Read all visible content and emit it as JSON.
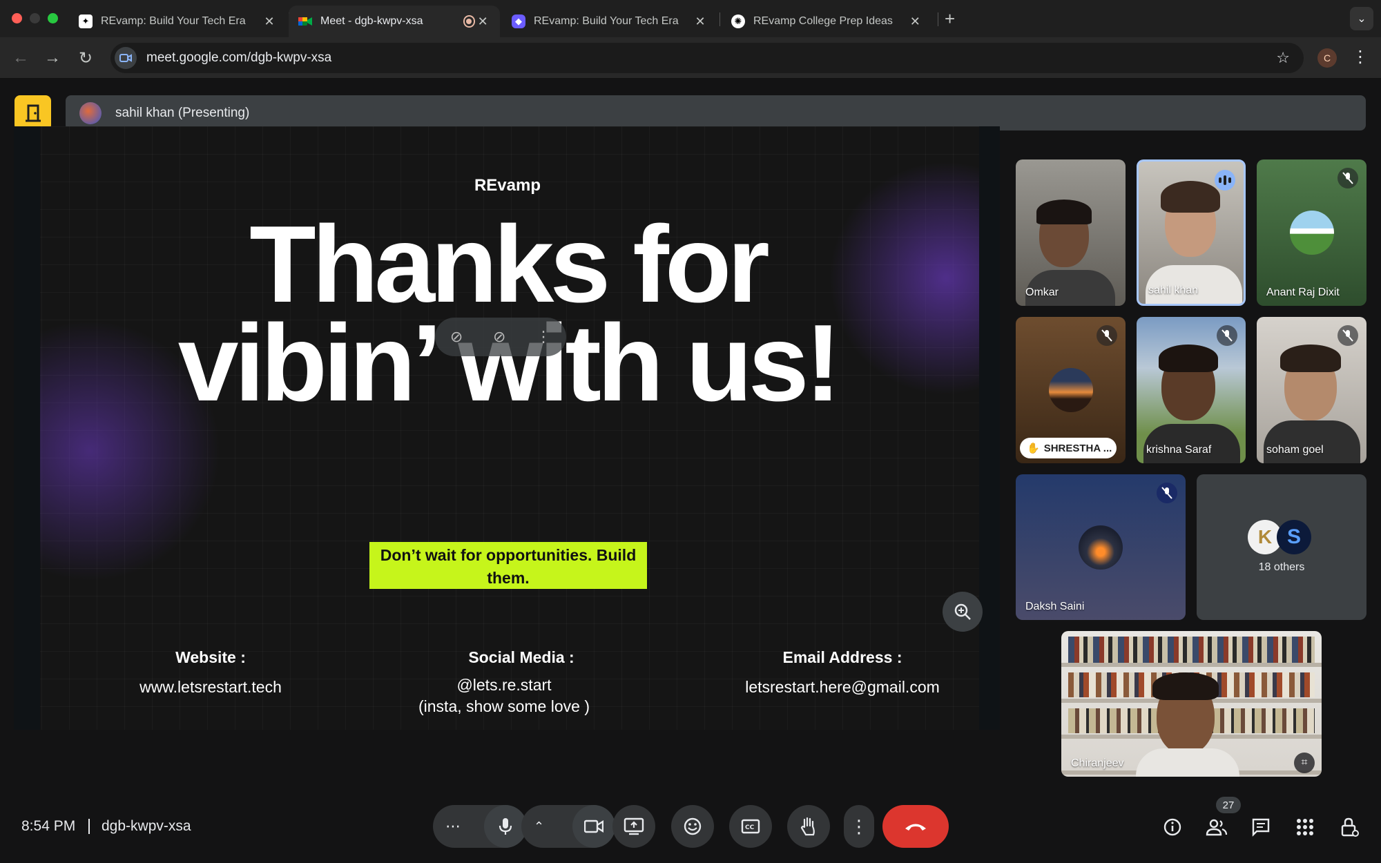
{
  "browser": {
    "tabs": [
      {
        "title": "REvamp: Build Your Tech Era"
      },
      {
        "title": "Meet - dgb-kwpv-xsa"
      },
      {
        "title": "REvamp: Build Your Tech Era"
      },
      {
        "title": "REvamp College Prep Ideas"
      }
    ],
    "url": "meet.google.com/dgb-kwpv-xsa",
    "profile_initial": "C"
  },
  "meet": {
    "presenter_label": "sahil khan (Presenting)",
    "slide": {
      "brand": "REvamp",
      "headline_line1": "Thanks for",
      "headline_line2": "vibin’ with us!",
      "cta": "Don’t wait for opportunities. Build them.",
      "website_label": "Website :",
      "website_value": "www.letsrestart.tech",
      "social_label": "Social Media :",
      "social_value_1": "@lets.re.start",
      "social_value_2": "(insta, show some love )",
      "email_label": "Email Address :",
      "email_value": "letsrestart.here@gmail.com"
    },
    "participants": [
      {
        "name": "Omkar"
      },
      {
        "name": "sahil khan"
      },
      {
        "name": "Anant Raj Dixit"
      },
      {
        "name": "SHRESTHA ..."
      },
      {
        "name": "krishna Saraf"
      },
      {
        "name": "soham goel"
      },
      {
        "name": "Daksh Saini"
      },
      {
        "name": "Chiranjeev"
      }
    ],
    "others_label": "18 others",
    "others_initials": [
      "K",
      "S"
    ],
    "participant_count": "27"
  },
  "bottom_bar": {
    "time": "8:54 PM",
    "meeting_code": "dgb-kwpv-xsa"
  },
  "colors": {
    "accent_yellow": "#f9c623",
    "cta_green": "#c6f51b",
    "end_call_red": "#dc362e",
    "speaking_blue": "#8ab4f8"
  }
}
